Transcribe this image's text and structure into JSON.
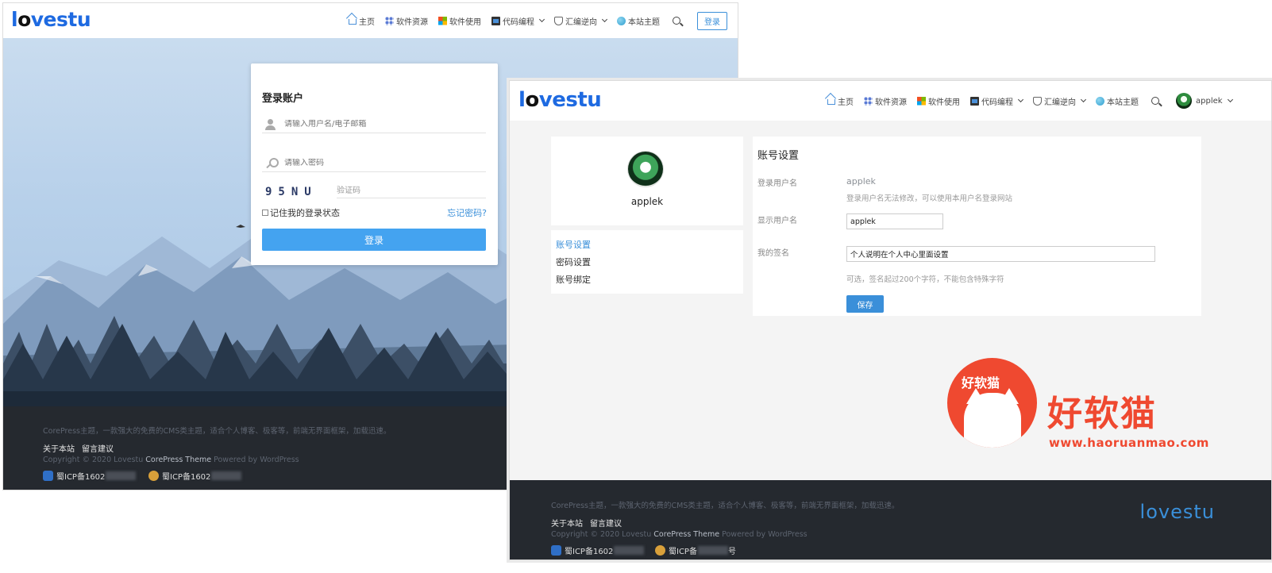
{
  "left_window": {
    "logo": "lovestu",
    "nav": {
      "items": [
        "主页",
        "软件资源",
        "软件使用",
        "代码编程",
        "汇编逆向",
        "本站主题"
      ],
      "login_label": "登录"
    },
    "login_card": {
      "title": "登录账户",
      "username_placeholder": "请输入用户名/电子邮箱",
      "password_placeholder": "请输入密码",
      "captcha_text": "95NU",
      "captcha_placeholder": "验证码",
      "remember_label": "记住我的登录状态",
      "forgot_label": "忘记密码?",
      "submit_label": "登录"
    },
    "footer": {
      "tagline": "CorePress主题，一款强大的免费的CMS类主题，适合个人博客、极客等，前端无界面框架，加载迅速。",
      "links": [
        "关于本站",
        "留言建议"
      ],
      "copyright_prefix": "Copyright © 2020 Lovestu",
      "copyright_theme": "CorePress Theme",
      "copyright_suffix": "Powered by WordPress",
      "icp_1": "蜀ICP备1602",
      "icp_2": "蜀ICP备1602"
    }
  },
  "right_window": {
    "logo": "lovestu",
    "nav": {
      "items": [
        "主页",
        "软件资源",
        "软件使用",
        "代码编程",
        "汇编逆向",
        "本站主题"
      ],
      "username": "applek"
    },
    "profile": {
      "username": "applek",
      "menu": [
        "账号设置",
        "密码设置",
        "账号绑定"
      ]
    },
    "settings": {
      "title": "账号设置",
      "login_name_label": "登录用户名",
      "login_name_value": "applek",
      "login_name_hint": "登录用户名无法修改，可以使用本用户名登录网站",
      "display_name_label": "显示用户名",
      "display_name_value": "applek",
      "signature_label": "我的签名",
      "signature_value": "个人说明在个人中心里面设置",
      "signature_hint": "可选，签名起过200个字符，不能包含特殊字符",
      "save_label": "保存"
    },
    "footer": {
      "tagline": "CorePress主题，一款强大的免费的CMS类主题，适合个人博客、极客等，前端无界面框架，加载迅速。",
      "links": [
        "关于本站",
        "留言建议"
      ],
      "copyright_prefix": "Copyright © 2020 Lovestu",
      "copyright_theme": "CorePress Theme",
      "copyright_suffix": "Powered by WordPress",
      "icp_1": "蜀ICP备1602",
      "icp_2": "蜀ICP备",
      "icp_2_suffix": "号",
      "logo": "lovestu"
    }
  },
  "watermark": {
    "badge_text": "好软猫",
    "big_text": "好软猫",
    "url": "www.haoruanmao.com"
  },
  "colors": {
    "brand_blue": "#1e6ae1",
    "accent_blue": "#3a8fd9",
    "footer_bg": "#25292f",
    "watermark_red": "#ef4930"
  }
}
